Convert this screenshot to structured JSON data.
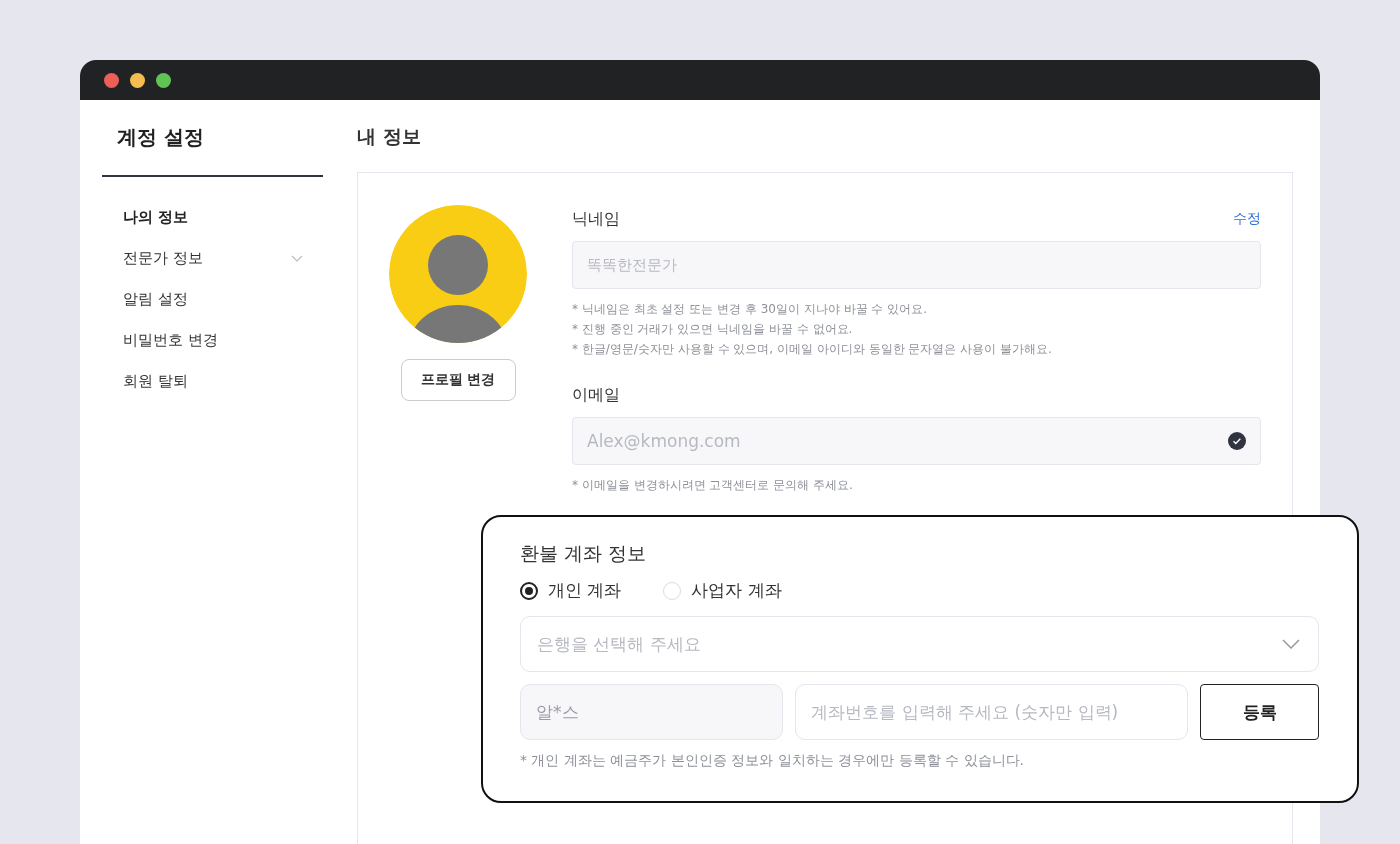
{
  "sidebar": {
    "title": "계정 설정",
    "items": [
      {
        "label": "나의 정보",
        "selected": true,
        "expandable": false
      },
      {
        "label": "전문가 정보",
        "selected": false,
        "expandable": true
      },
      {
        "label": "알림 설정",
        "selected": false,
        "expandable": false
      },
      {
        "label": "비밀번호 변경",
        "selected": false,
        "expandable": false
      },
      {
        "label": "회원 탈퇴",
        "selected": false,
        "expandable": false
      }
    ]
  },
  "page_title": "내 정보",
  "profile": {
    "button": "프로필 변경"
  },
  "nickname": {
    "label": "닉네임",
    "edit_link": "수정",
    "placeholder": "똑똑한전문가",
    "notes": [
      "* 닉네임은 최초 설정 또는 변경 후 30일이 지나야 바꿀 수 있어요.",
      "* 진행 중인 거래가 있으면 닉네임을 바꿀 수 없어요.",
      "* 한글/영문/숫자만 사용할 수 있으며, 이메일 아이디와 동일한 문자열은 사용이 불가해요."
    ]
  },
  "email": {
    "label": "이메일",
    "placeholder": "Alex@kmong.com",
    "verified": true,
    "note": "* 이메일을 변경하시려면 고객센터로 문의해 주세요."
  },
  "refund": {
    "title": "환불 계좌 정보",
    "account_types": [
      {
        "label": "개인 계좌",
        "selected": true
      },
      {
        "label": "사업자 계좌",
        "selected": false
      }
    ],
    "bank_select": {
      "placeholder": "은행을 선택해 주세요"
    },
    "holder": {
      "placeholder": "알*스",
      "disabled": true
    },
    "account_number": {
      "placeholder": "계좌번호를 입력해 주세요 (숫자만 입력)"
    },
    "register_button": "등록",
    "note": "* 개인 계좌는 예금주가 본인인증 정보와 일치하는 경우에만 등록할 수 있습니다."
  }
}
